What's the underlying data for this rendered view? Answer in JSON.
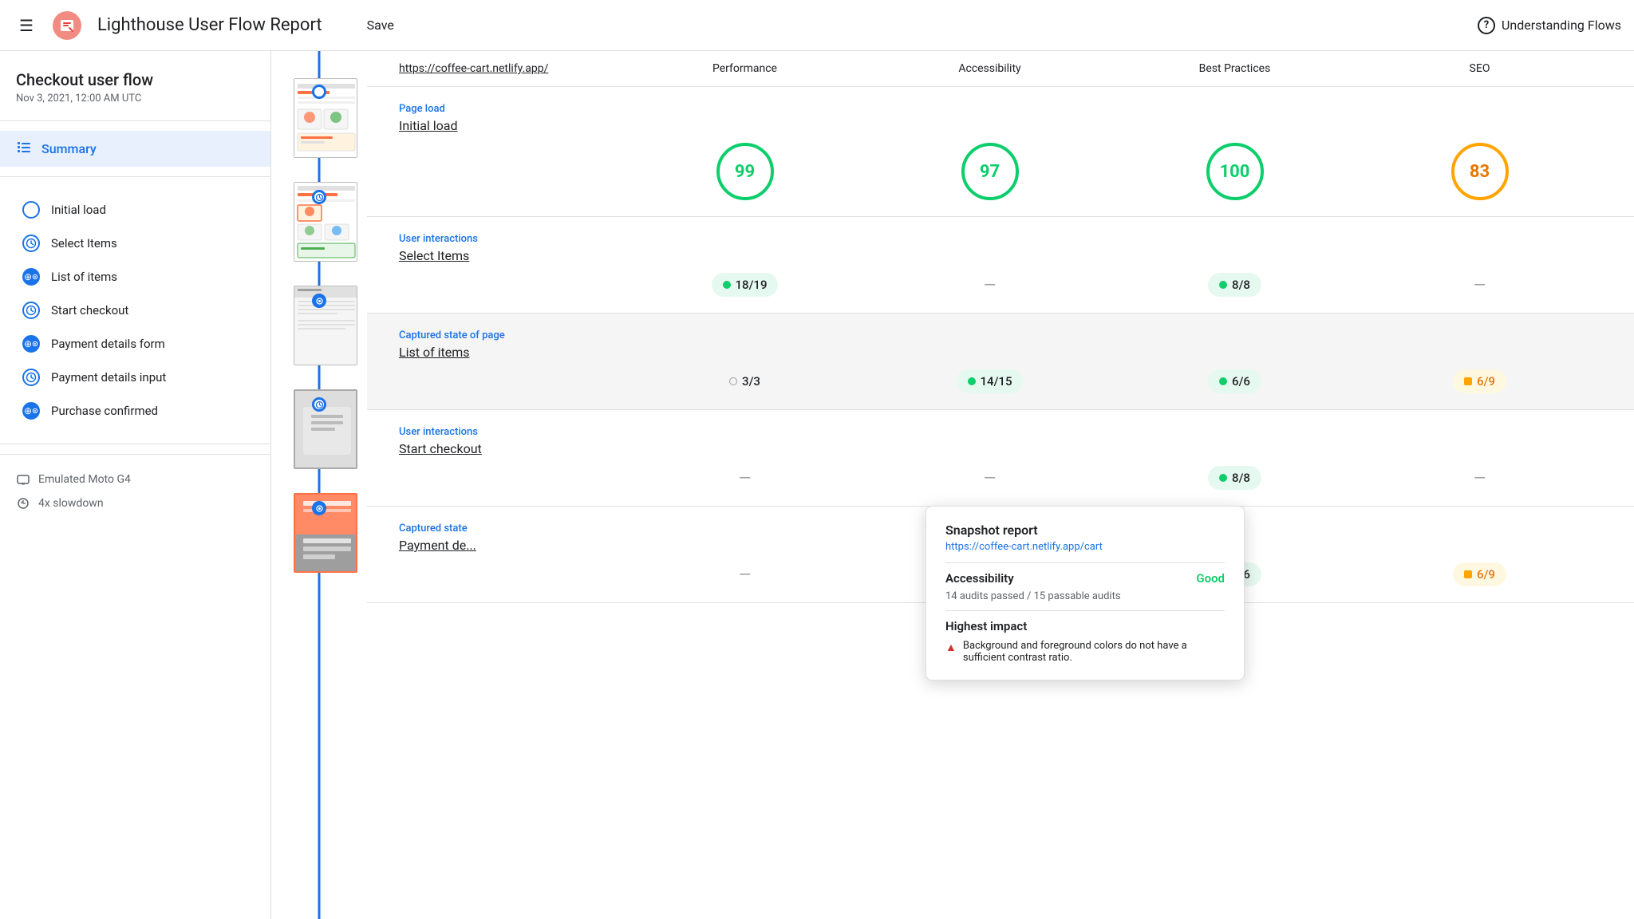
{
  "app": {
    "title": "Lighthouse User Flow Report",
    "save_label": "Save",
    "help_label": "Understanding Flows",
    "logo_emoji": "🔱"
  },
  "sidebar": {
    "flow_title": "Checkout user flow",
    "flow_date": "Nov 3, 2021, 12:00 AM UTC",
    "summary_label": "Summary",
    "nav_items": [
      {
        "id": "initial-load",
        "label": "Initial load",
        "icon": "circle"
      },
      {
        "id": "select-items",
        "label": "Select Items",
        "icon": "clock"
      },
      {
        "id": "list-of-items",
        "label": "List of items",
        "icon": "snapshot"
      },
      {
        "id": "start-checkout",
        "label": "Start checkout",
        "icon": "clock"
      },
      {
        "id": "payment-details-form",
        "label": "Payment details form",
        "icon": "snapshot"
      },
      {
        "id": "payment-details-input",
        "label": "Payment details input",
        "icon": "clock"
      },
      {
        "id": "purchase-confirmed",
        "label": "Purchase confirmed",
        "icon": "snapshot"
      }
    ],
    "device_label": "Emulated Moto G4",
    "slowdown_label": "4x slowdown"
  },
  "report": {
    "url": "https://coffee-cart.netlify.app/",
    "columns": [
      "Performance",
      "Accessibility",
      "Best Practices",
      "SEO"
    ],
    "sections": [
      {
        "id": "initial-load-row",
        "type": "Page load",
        "name": "Initial load",
        "scores": [
          {
            "type": "circle",
            "value": "99",
            "color": "green"
          },
          {
            "type": "circle",
            "value": "97",
            "color": "green"
          },
          {
            "type": "circle",
            "value": "100",
            "color": "green"
          },
          {
            "type": "circle",
            "value": "83",
            "color": "orange"
          }
        ]
      },
      {
        "id": "select-items-row",
        "type": "User interactions",
        "name": "Select Items",
        "scores": [
          {
            "type": "badge",
            "value": "18/19",
            "color": "green"
          },
          {
            "type": "dash"
          },
          {
            "type": "badge",
            "value": "8/8",
            "color": "green"
          },
          {
            "type": "dash"
          }
        ]
      },
      {
        "id": "list-of-items-row",
        "type": "Captured state of page",
        "name": "List of items",
        "highlighted": true,
        "scores": [
          {
            "type": "badge",
            "value": "3/3",
            "color": "gray"
          },
          {
            "type": "badge",
            "value": "14/15",
            "color": "green"
          },
          {
            "type": "badge",
            "value": "6/6",
            "color": "green"
          },
          {
            "type": "badge",
            "value": "6/9",
            "color": "orange"
          }
        ]
      },
      {
        "id": "start-checkout-row",
        "type": "User interactions",
        "name": "Start checkout",
        "scores": [
          {
            "type": "dash"
          },
          {
            "type": "dash"
          },
          {
            "type": "badge",
            "value": "8/8",
            "color": "green"
          },
          {
            "type": "dash"
          }
        ]
      },
      {
        "id": "payment-details-row",
        "type": "Captured state",
        "name": "Payment de...",
        "scores": [
          {
            "type": "dash"
          },
          {
            "type": "dash"
          },
          {
            "type": "badge",
            "value": "6/6",
            "color": "green"
          },
          {
            "type": "badge",
            "value": "6/9",
            "color": "orange"
          }
        ]
      }
    ]
  },
  "tooltip": {
    "title": "Snapshot report",
    "url": "https://coffee-cart.netlify.app/cart",
    "section": "Accessibility",
    "section_status": "Good",
    "section_desc": "14 audits passed / 15 passable audits",
    "impact_title": "Highest impact",
    "impact_items": [
      {
        "icon": "warning",
        "text": "Background and foreground colors do not have a sufficient contrast ratio."
      }
    ]
  },
  "icons": {
    "hamburger": "☰",
    "logo": "🔱",
    "question": "?",
    "clock": "🕐",
    "device": "▭",
    "thunder": "⚡"
  }
}
